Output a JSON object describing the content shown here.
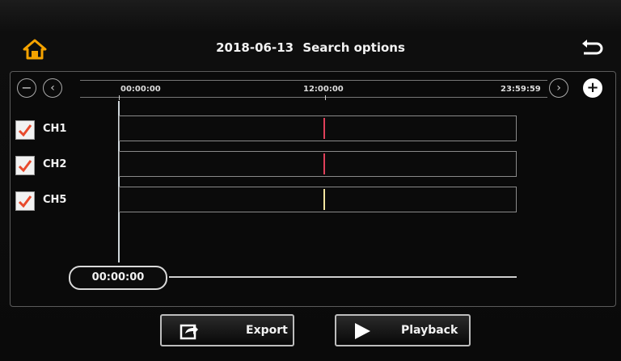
{
  "header": {
    "date": "2018-06-13",
    "title": "Search options"
  },
  "timeline": {
    "start": "00:00:00",
    "mid": "12:00:00",
    "end": "23:59:59"
  },
  "channels": [
    {
      "label": "CH1",
      "checked": true,
      "marker_color": "#e0405a",
      "marker_time_fraction": 0.515
    },
    {
      "label": "CH2",
      "checked": true,
      "marker_color": "#e0405a",
      "marker_time_fraction": 0.515
    },
    {
      "label": "CH5",
      "checked": true,
      "marker_color": "#f4e6a0",
      "marker_time_fraction": 0.515
    }
  ],
  "slider": {
    "time": "00:00:00"
  },
  "buttons": {
    "export": "Export",
    "playback": "Playback"
  },
  "colors": {
    "home_icon": "#f5a300",
    "check": "#e84a2c"
  }
}
